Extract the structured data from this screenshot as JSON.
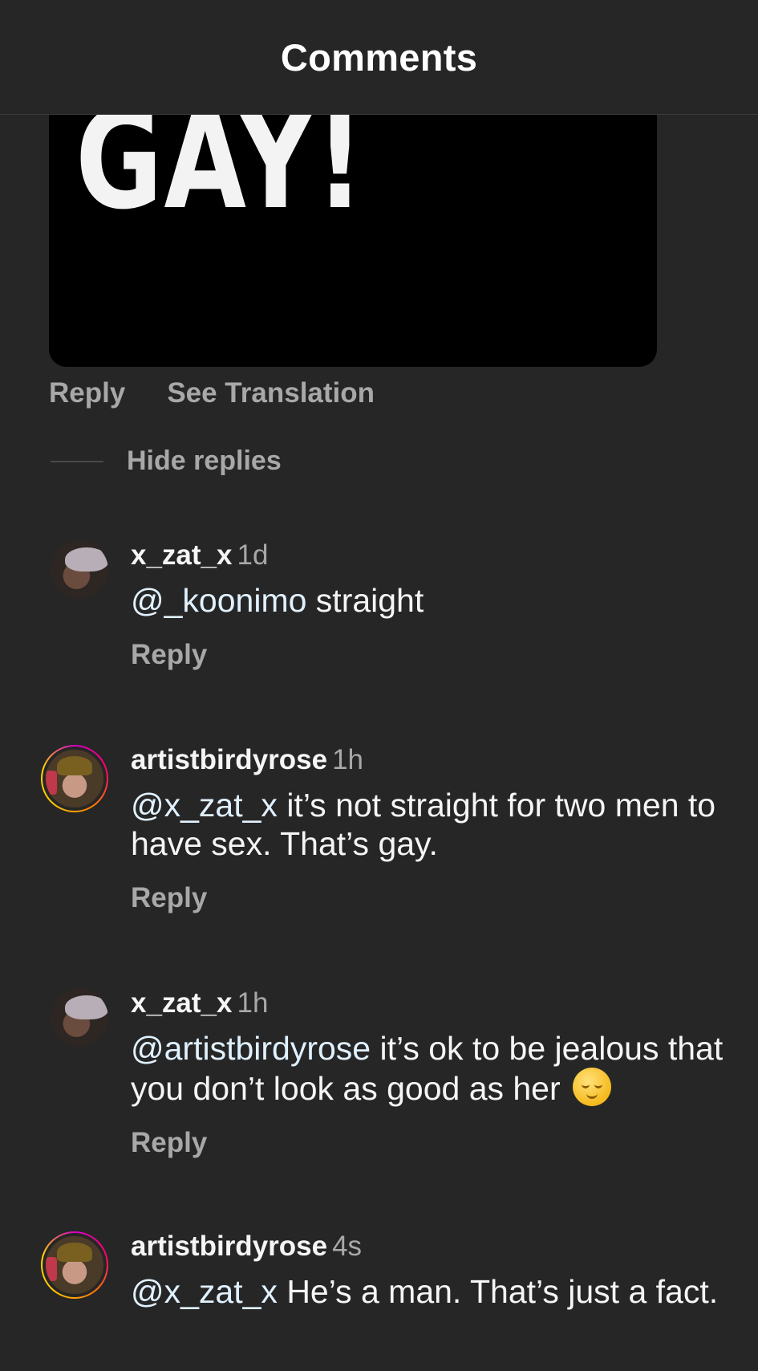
{
  "header": {
    "title": "Comments"
  },
  "media": {
    "text": "GAY!"
  },
  "parent_actions": {
    "reply": "Reply",
    "translate": "See Translation"
  },
  "replies_toggle": {
    "label": "Hide replies"
  },
  "comments": [
    {
      "username": "x_zat_x",
      "time": "1d",
      "mention": "@_koonimo",
      "text": " straight",
      "reply": "Reply",
      "avatar": "user-avatar"
    },
    {
      "username": "artistbirdyrose",
      "time": "1h",
      "mention": "@x_zat_x",
      "text": " it’s not straight for two men to have sex. That’s gay.",
      "reply": "Reply",
      "avatar": "story-ring-avatar"
    },
    {
      "username": "x_zat_x",
      "time": "1h",
      "mention": "@artistbirdyrose",
      "text": " it’s ok to be jealous that you don’t look as good as her ",
      "emoji": "relieved-face-emoji",
      "reply": "Reply",
      "avatar": "user-avatar"
    },
    {
      "username": "artistbirdyrose",
      "time": "4s",
      "mention": "@x_zat_x",
      "text": " He’s a man. That’s just a fact.",
      "avatar": "story-ring-avatar"
    }
  ],
  "colors": {
    "background": "#262626",
    "secondary_text": "#a8a8a8",
    "mention": "#e0f1ff",
    "primary_text": "#f5f5f5"
  }
}
